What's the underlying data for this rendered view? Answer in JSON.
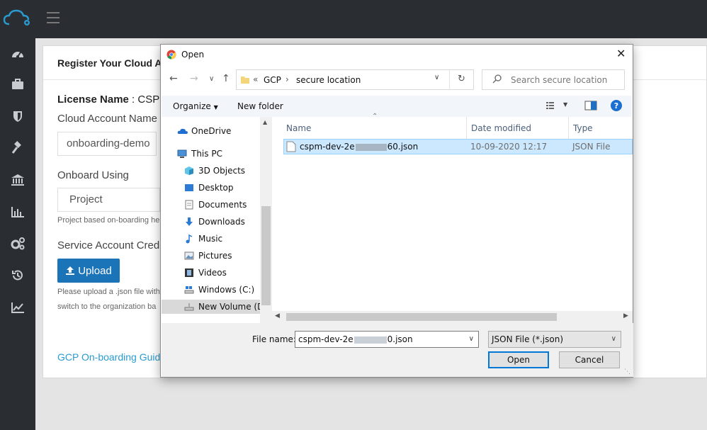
{
  "app": {
    "colors": {
      "sidebar": "#2a2d31",
      "accent": "#1b73b8",
      "link": "#2a9bd1"
    },
    "logo_icon": "cloud-gear-icon",
    "menu_icon": "hamburger-icon"
  },
  "sidebar": {
    "items": [
      {
        "icon": "dashboard-icon"
      },
      {
        "icon": "briefcase-icon"
      },
      {
        "icon": "shield-icon"
      },
      {
        "icon": "gavel-icon"
      },
      {
        "icon": "bank-icon"
      },
      {
        "icon": "bar-chart-icon"
      },
      {
        "icon": "cogs-icon"
      },
      {
        "icon": "history-icon"
      },
      {
        "icon": "line-chart-icon"
      }
    ]
  },
  "form": {
    "title": "Register Your Cloud A",
    "license_label": "License Name",
    "license_value": " : CSPM",
    "account_name_label": "Cloud Account Name",
    "account_name_value": "onboarding-demo",
    "onboard_using_label": "Onboard Using",
    "onboard_using_value": "Project",
    "onboard_help": "Project based on-boarding he",
    "service_account_label": "Service Account Creden",
    "upload_label": "Upload",
    "upload_help_1": "Please upload a .json file with",
    "upload_help_2": "switch to the organization ba",
    "guide_link": "GCP On-boarding Guid"
  },
  "dialog": {
    "title": "Open",
    "close_glyph": "✕",
    "breadcrumb_prefix": "«",
    "breadcrumb": [
      "GCP",
      "secure location"
    ],
    "search_placeholder": "Search secure location",
    "organize_label": "Organize",
    "new_folder_label": "New folder",
    "nav_items": [
      {
        "label": "OneDrive",
        "icon": "onedrive-icon"
      },
      {
        "label": "This PC",
        "icon": "computer-icon"
      },
      {
        "label": "3D Objects",
        "icon": "3d-objects-icon"
      },
      {
        "label": "Desktop",
        "icon": "desktop-icon"
      },
      {
        "label": "Documents",
        "icon": "documents-icon"
      },
      {
        "label": "Downloads",
        "icon": "downloads-icon"
      },
      {
        "label": "Music",
        "icon": "music-icon"
      },
      {
        "label": "Pictures",
        "icon": "pictures-icon"
      },
      {
        "label": "Videos",
        "icon": "videos-icon"
      },
      {
        "label": "Windows (C:)",
        "icon": "drive-c-icon"
      },
      {
        "label": "New Volume (D:",
        "icon": "drive-d-icon"
      }
    ],
    "columns": {
      "name": "Name",
      "date": "Date modified",
      "type": "Type"
    },
    "files": [
      {
        "name_start": "cspm-dev-2e",
        "name_end": "60.json",
        "date": "10-09-2020 12:17",
        "type": "JSON File"
      }
    ],
    "file_name_label": "File name:",
    "file_name_start": "cspm-dev-2e",
    "file_name_end": "0.json",
    "file_type": "JSON File (*.json)",
    "open_label": "Open",
    "cancel_label": "Cancel"
  }
}
